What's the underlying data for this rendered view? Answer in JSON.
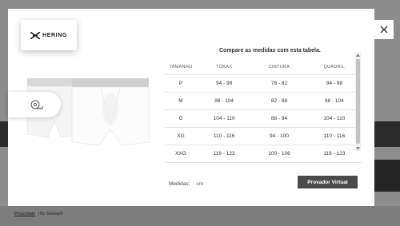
{
  "modal": {
    "brand": "HERING",
    "table_title": "Compare as medidas com esta tabela.",
    "headers": [
      "TAMANHO",
      "TÓRAX",
      "CINTURA",
      "QUADRIL"
    ],
    "rows": [
      [
        "P",
        "94 - 98",
        "78 - 82",
        "94 - 98"
      ],
      [
        "M",
        "98 - 104",
        "82 - 88",
        "98 - 104"
      ],
      [
        "G",
        "104 - 110",
        "88 - 94",
        "104 - 110"
      ],
      [
        "XG",
        "110 - 116",
        "94 - 100",
        "110 - 116"
      ],
      [
        "XXG",
        "116 - 123",
        "100 - 106",
        "116 - 123"
      ]
    ],
    "measures_label": "Medidas:",
    "measures_unit": "cm",
    "virtual_tryon_label": "Provador Virtual"
  },
  "background": {
    "footer_privacy": "Privacidade",
    "footer_by": "| By Sizebay®"
  },
  "icons": {
    "close": "close-icon",
    "brand_mark": "hering-logo-icon",
    "tape": "measuring-tape-icon"
  },
  "colors": {
    "button_bg": "#4a4a4a",
    "overlay": "#1e1e1e"
  }
}
